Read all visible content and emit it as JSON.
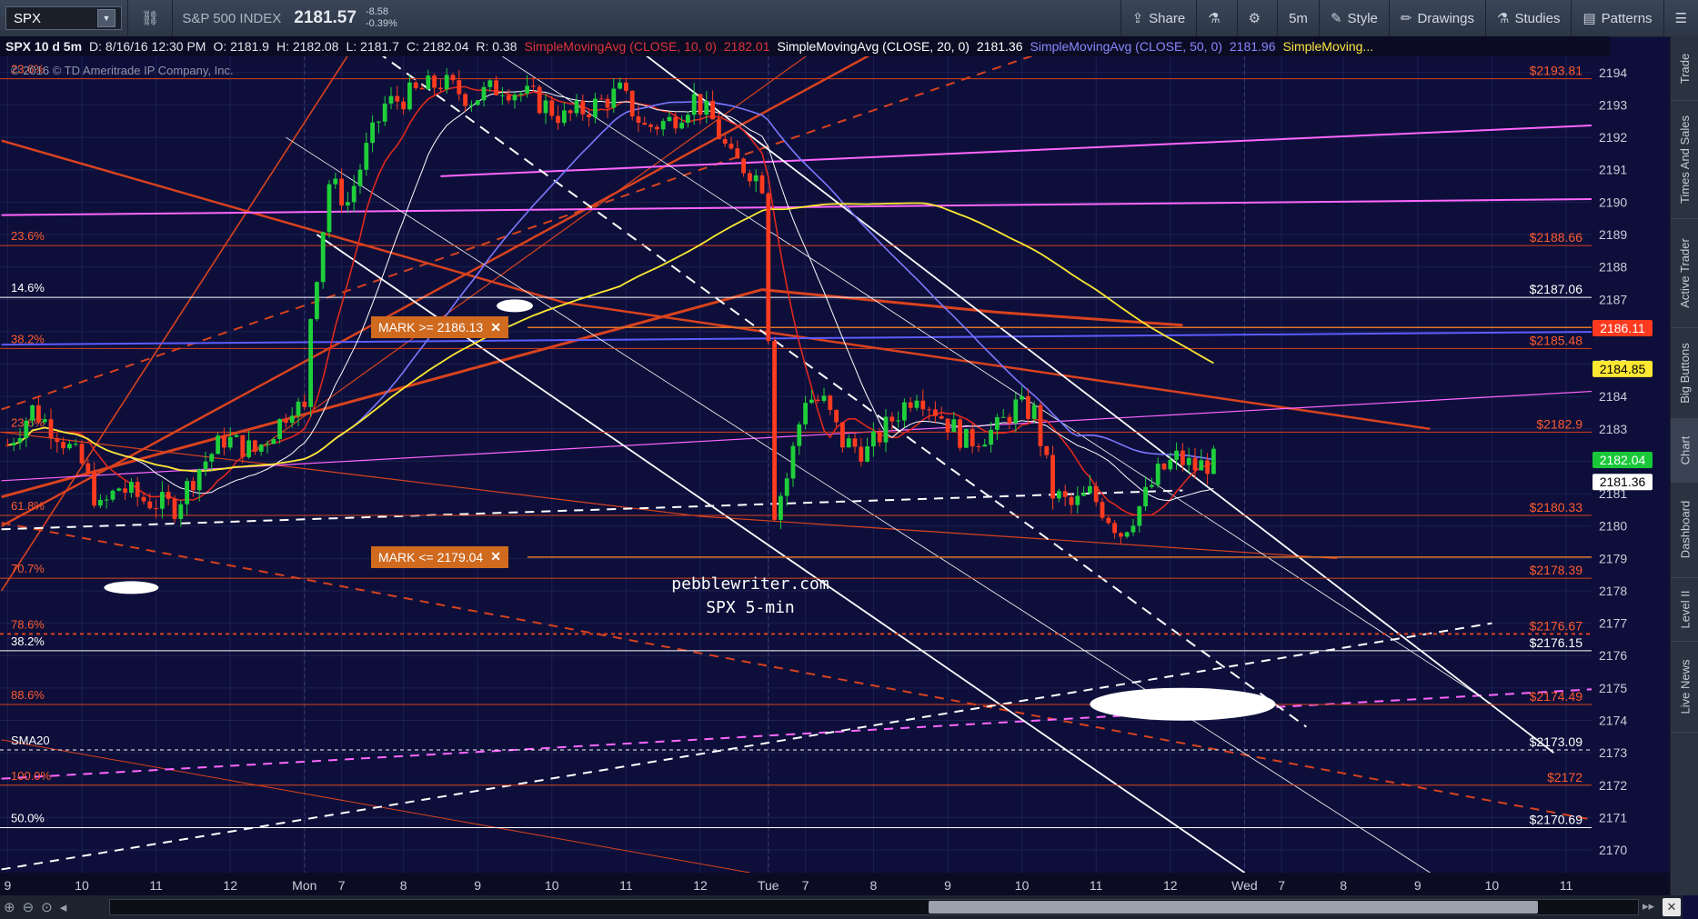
{
  "toolbar": {
    "symbol": "SPX",
    "name": "S&P 500 INDEX",
    "last": "2181.57",
    "change": "-8.58",
    "change_pct": "-0.39%",
    "buttons": [
      {
        "label": "Share",
        "icon": "share-icon"
      },
      {
        "label": "",
        "icon": "flask-icon"
      },
      {
        "label": "",
        "icon": "gear-icon"
      },
      {
        "label": "5m",
        "icon": ""
      },
      {
        "label": "Style",
        "icon": "style-icon"
      },
      {
        "label": "Drawings",
        "icon": "pencil-icon"
      },
      {
        "label": "Studies",
        "icon": "flask-icon"
      },
      {
        "label": "Patterns",
        "icon": "patterns-icon"
      }
    ]
  },
  "status": {
    "title": "SPX 10 d 5m",
    "date": "D: 8/16/16 12:30 PM",
    "open": "O: 2181.9",
    "high": "H: 2182.08",
    "low": "L: 2181.7",
    "close": "C: 2182.04",
    "range": "R: 0.38",
    "sma10": "SimpleMovingAvg (CLOSE, 10, 0)",
    "sma10_val": "2182.01",
    "sma20": "SimpleMovingAvg (CLOSE, 20, 0)",
    "sma20_val": "2181.36",
    "sma50": "SimpleMovingAvg (CLOSE, 50, 0)",
    "sma50_val": "2181.96",
    "sma_more": "SimpleMoving..."
  },
  "copyright": "© 2016 © TD Ameritrade IP Company, Inc.",
  "watermark": {
    "line1": "pebblewriter.com",
    "line2": "SPX 5-min"
  },
  "marks": [
    {
      "label": "MARK >= 2186.13",
      "price": 2186.13
    },
    {
      "label": "MARK <= 2179.04",
      "price": 2179.04
    }
  ],
  "sidebar_tabs": [
    "Trade",
    "Times And Sales",
    "Active Trader",
    "Big Buttons",
    "Chart",
    "Dashboard",
    "Level II",
    "Live News"
  ],
  "colors": {
    "background": "#0d0f3a",
    "candle_up": "#1fcf3a",
    "candle_down": "#ff3b1f",
    "sma10": "#e0281e",
    "sma20": "#ffffff",
    "sma50": "#7b78ff",
    "sma_long": "#ffe832",
    "fib_line": "#d9421e",
    "magenta": "#ff66ff"
  },
  "chart_data": {
    "type": "candlestick",
    "title": "SPX 10 d 5m",
    "ylim": [
      2169.3,
      2194.5
    ],
    "y_ticks": [
      2170,
      2171,
      2172,
      2173,
      2174,
      2175,
      2176,
      2177,
      2178,
      2179,
      2180,
      2181,
      2182,
      2183,
      2184,
      2185,
      2186,
      2187,
      2188,
      2189,
      2190,
      2191,
      2192,
      2193,
      2194
    ],
    "x_ticks": [
      {
        "i": 0,
        "label": "9"
      },
      {
        "i": 12,
        "label": "10"
      },
      {
        "i": 24,
        "label": "11"
      },
      {
        "i": 36,
        "label": "12"
      },
      {
        "i": 48,
        "label": "Mon"
      },
      {
        "i": 54,
        "label": "7"
      },
      {
        "i": 64,
        "label": "8"
      },
      {
        "i": 76,
        "label": "9"
      },
      {
        "i": 88,
        "label": "10"
      },
      {
        "i": 100,
        "label": "11"
      },
      {
        "i": 112,
        "label": "12"
      },
      {
        "i": 123,
        "label": "Tue"
      },
      {
        "i": 129,
        "label": "7"
      },
      {
        "i": 140,
        "label": "8"
      },
      {
        "i": 152,
        "label": "9"
      },
      {
        "i": 164,
        "label": "10"
      },
      {
        "i": 176,
        "label": "11"
      },
      {
        "i": 188,
        "label": "12"
      },
      {
        "i": 200,
        "label": "Wed"
      },
      {
        "i": 206,
        "label": "7"
      },
      {
        "i": 216,
        "label": "8"
      },
      {
        "i": 228,
        "label": "9"
      },
      {
        "i": 240,
        "label": "10"
      },
      {
        "i": 252,
        "label": "11"
      }
    ],
    "bar_count": 260,
    "close_anchors": [
      [
        0,
        2182.5
      ],
      [
        4,
        2183.6
      ],
      [
        8,
        2182.9
      ],
      [
        12,
        2181.9
      ],
      [
        15,
        2180.5
      ],
      [
        18,
        2181.2
      ],
      [
        22,
        2180.8
      ],
      [
        27,
        2180.6
      ],
      [
        31,
        2181.8
      ],
      [
        35,
        2182.7
      ],
      [
        40,
        2182.3
      ],
      [
        44,
        2183.2
      ],
      [
        46,
        2183.8
      ],
      [
        48,
        2183.5
      ],
      [
        49,
        2186.5
      ],
      [
        52,
        2190.6
      ],
      [
        55,
        2190.0
      ],
      [
        58,
        2191.6
      ],
      [
        61,
        2193.0
      ],
      [
        65,
        2193.3
      ],
      [
        70,
        2193.7
      ],
      [
        75,
        2193.2
      ],
      [
        80,
        2193.6
      ],
      [
        85,
        2193.2
      ],
      [
        90,
        2192.6
      ],
      [
        95,
        2193.0
      ],
      [
        99,
        2193.4
      ],
      [
        103,
        2192.3
      ],
      [
        107,
        2192.5
      ],
      [
        111,
        2193.2
      ],
      [
        114,
        2192.5
      ],
      [
        117,
        2191.3
      ],
      [
        120,
        2191.0
      ],
      [
        122,
        2190.6
      ],
      [
        123,
        2186.0
      ],
      [
        124,
        2180.5
      ],
      [
        126,
        2181.5
      ],
      [
        129,
        2184.0
      ],
      [
        132,
        2183.8
      ],
      [
        135,
        2182.6
      ],
      [
        139,
        2182.3
      ],
      [
        143,
        2183.3
      ],
      [
        147,
        2184.2
      ],
      [
        151,
        2183.4
      ],
      [
        155,
        2182.6
      ],
      [
        160,
        2183.0
      ],
      [
        163,
        2183.7
      ],
      [
        166,
        2183.5
      ],
      [
        169,
        2181.0
      ],
      [
        172,
        2180.6
      ],
      [
        175,
        2181.0
      ],
      [
        178,
        2180.3
      ],
      [
        180,
        2179.8
      ],
      [
        183,
        2180.6
      ],
      [
        186,
        2181.6
      ],
      [
        189,
        2182.1
      ],
      [
        192,
        2181.8
      ],
      [
        195,
        2182.0
      ]
    ],
    "last_index": 195,
    "price_labels": [
      {
        "price": 2193.81,
        "text": "$2193.81"
      },
      {
        "price": 2188.66,
        "text": "$2188.66"
      },
      {
        "price": 2187.06,
        "text": "$2187.06"
      },
      {
        "price": 2185.48,
        "text": "$2185.48"
      },
      {
        "price": 2182.9,
        "text": "$2182.9"
      },
      {
        "price": 2180.33,
        "text": "$2180.33"
      },
      {
        "price": 2178.39,
        "text": "$2178.39"
      },
      {
        "price": 2176.67,
        "text": "$2176.67"
      },
      {
        "price": 2176.15,
        "text": "$2176.15"
      },
      {
        "price": 2174.49,
        "text": "$2174.49"
      },
      {
        "price": 2173.09,
        "text": "$2173.09"
      },
      {
        "price": 2172.0,
        "text": "$2172"
      },
      {
        "price": 2170.69,
        "text": "$2170.69"
      }
    ],
    "axis_tags": [
      {
        "price": 2186.11,
        "text": "2186.11",
        "bg": "#ff3a1f",
        "fg": "#ffffff"
      },
      {
        "price": 2184.85,
        "text": "2184.85",
        "bg": "#ffe832",
        "fg": "#000000"
      },
      {
        "price": 2182.04,
        "text": "2182.04",
        "bg": "#19c838",
        "fg": "#ffffff"
      },
      {
        "price": 2181.36,
        "text": "2181.36",
        "bg": "#ffffff",
        "fg": "#000000"
      }
    ],
    "fib_labels": [
      {
        "price": 2193.81,
        "text": "23.6%"
      },
      {
        "price": 2188.66,
        "text": "23.6%"
      },
      {
        "price": 2187.06,
        "text": "14.6%"
      },
      {
        "price": 2185.48,
        "text": "38.2%"
      },
      {
        "price": 2182.9,
        "text": "23.6%"
      },
      {
        "price": 2180.33,
        "text": "61.8%"
      },
      {
        "price": 2178.39,
        "text": "70.7%"
      },
      {
        "price": 2176.67,
        "text": "78.6%"
      },
      {
        "price": 2176.15,
        "text": "38.2%"
      },
      {
        "price": 2174.49,
        "text": "88.6%"
      },
      {
        "price": 2173.09,
        "text": "SMA20"
      },
      {
        "price": 2172.0,
        "text": "100.0%"
      },
      {
        "price": 2170.69,
        "text": "50.0%"
      }
    ]
  }
}
